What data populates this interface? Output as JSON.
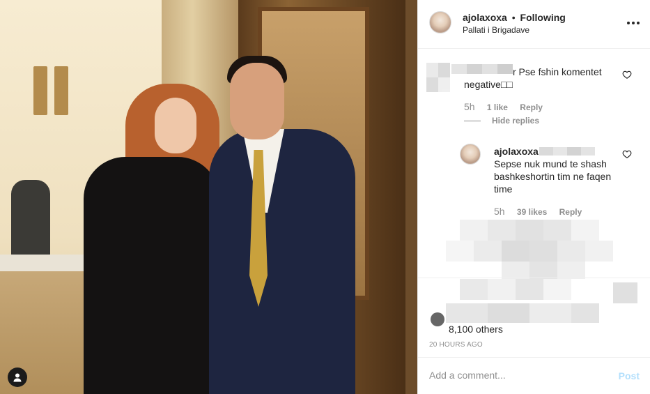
{
  "post": {
    "author": "ajolaxoxa",
    "separator": "•",
    "follow_status": "Following",
    "location": "Pallati i Brigadave"
  },
  "comments": [
    {
      "text_visible": "r Pse fshin komentet negative",
      "text_line2_suffix": "□□",
      "time": "5h",
      "likes": "1 like",
      "reply": "Reply"
    }
  ],
  "hide_replies": "Hide replies",
  "reply_comment": {
    "author": "ajolaxoxa",
    "text": "Sepse nuk mund te shash bashkeshortin tim ne faqen time",
    "time": "5h",
    "likes": "39 likes",
    "reply": "Reply"
  },
  "likes_text": "8,100 others",
  "timestamp": "20 HOURS AGO",
  "comment_box": {
    "placeholder": "Add a comment...",
    "post_label": "Post"
  },
  "icons": {
    "more": "more-options-icon",
    "heart": "heart-icon",
    "user": "user-tag-icon"
  }
}
